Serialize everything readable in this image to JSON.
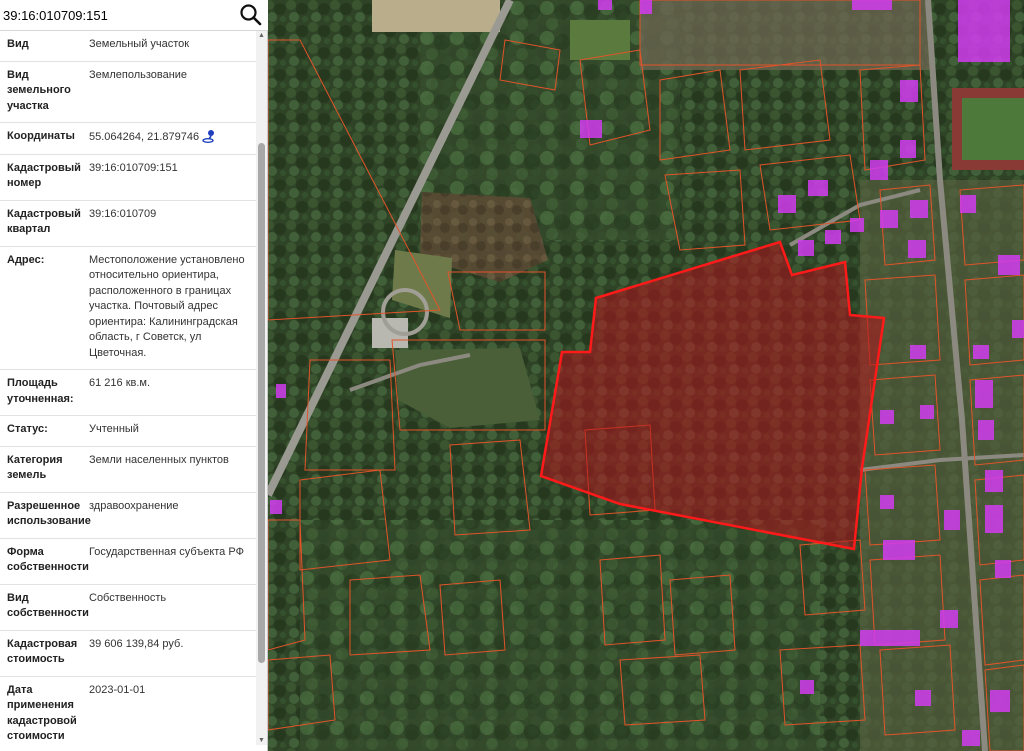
{
  "search": {
    "value": "39:16:010709:151"
  },
  "properties": [
    {
      "label": "Вид",
      "value": "Земельный участок"
    },
    {
      "label": "Вид земельного участка",
      "value": "Землепользование"
    },
    {
      "label": "Координаты",
      "value": "55.064264, 21.879746"
    },
    {
      "label": "Кадастровый номер",
      "value": "39:16:010709:151"
    },
    {
      "label": "Кадастровый квартал",
      "value": "39:16:010709"
    },
    {
      "label": "Адрес:",
      "value": "Местоположение установлено относительно ориентира, расположенного в границах участка. Почтовый адрес ориентира: Калининградская область, г Советск, ул Цветочная."
    },
    {
      "label": "Площадь уточненная:",
      "value": "61 216 кв.м."
    },
    {
      "label": "Статус:",
      "value": "Учтенный"
    },
    {
      "label": "Категория земель",
      "value": "Земли населенных пунктов"
    },
    {
      "label": "Разрешенное использование",
      "value": "здравоохранение"
    },
    {
      "label": "Форма собственности",
      "value": "Государственная субъекта РФ"
    },
    {
      "label": "Вид собственности",
      "value": "Собственность"
    },
    {
      "label": "Кадастровая стоимость",
      "value": "39 606 139,84 руб."
    },
    {
      "label": "Дата применения кадастровой стоимости",
      "value": "2023-01-01"
    }
  ],
  "icons": {
    "search": "search-icon",
    "coordinates": "location-pin-icon"
  },
  "colors": {
    "selected_parcel_outline": "#ff1a1a",
    "selected_parcel_fill": "#b4141e",
    "parcel_outline": "#e2542a",
    "building_highlight": "#d23cf0",
    "coord_icon": "#1f3fbf"
  }
}
